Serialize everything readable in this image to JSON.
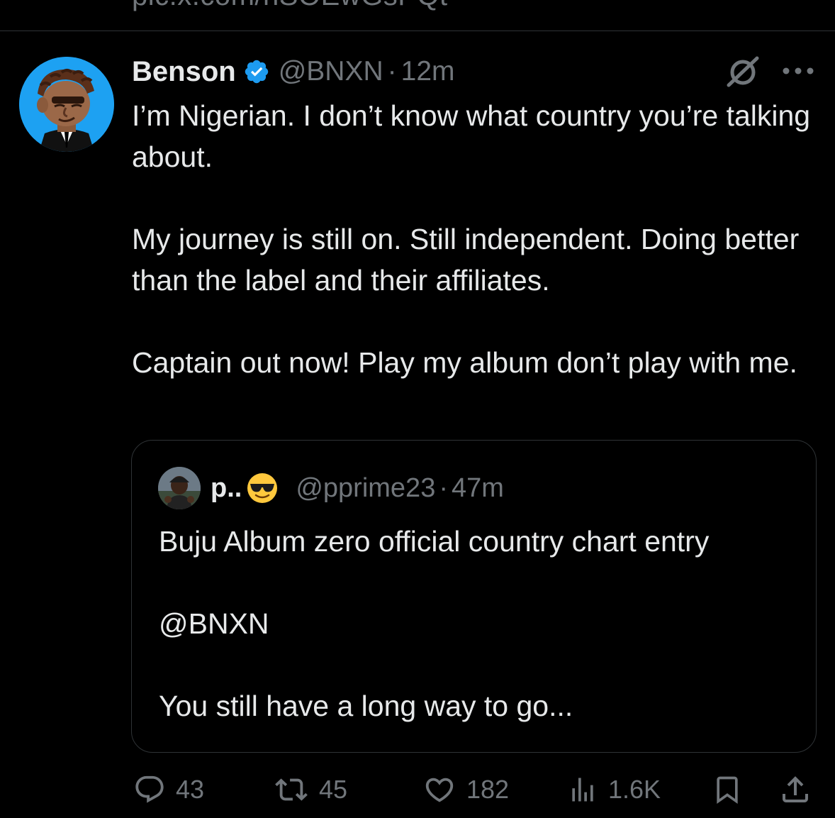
{
  "previous_tweet": {
    "link_text": "pic.x.com/nSOEwGsPQt"
  },
  "tweet": {
    "author": {
      "display_name": "Benson",
      "handle": "@BNXN",
      "verified": true
    },
    "separator": "·",
    "time": "12m",
    "paragraphs": [
      "I’m Nigerian. I don’t know what country you’re talking about.",
      "My journey is still on. Still independent. Doing better than the label and their affiliates.",
      "Captain out now! Play my album don’t play with me."
    ],
    "quoted": {
      "author": {
        "display_name": "p..",
        "emoji": "smiling-face-with-sunglasses",
        "handle": "@pprime23"
      },
      "separator": "·",
      "time": "47m",
      "paragraphs": [
        "Buju Album zero official country chart entry",
        "@BNXN",
        "You still have a long way to go..."
      ]
    },
    "actions": {
      "replies": "43",
      "reposts": "45",
      "likes": "182",
      "views": "1.6K"
    }
  },
  "colors": {
    "background": "#000000",
    "text_primary": "#e7e9ea",
    "text_secondary": "#71767b",
    "border": "#2f3336",
    "verified_blue": "#1d9bf0",
    "avatar_bg": "#1da1f2"
  },
  "icons": {
    "verified": "verified-badge-icon",
    "grok": "grok-icon",
    "more": "more-options-icon",
    "reply": "reply-icon",
    "repost": "repost-icon",
    "like": "heart-icon",
    "views": "views-icon",
    "bookmark": "bookmark-icon",
    "share": "share-icon"
  }
}
